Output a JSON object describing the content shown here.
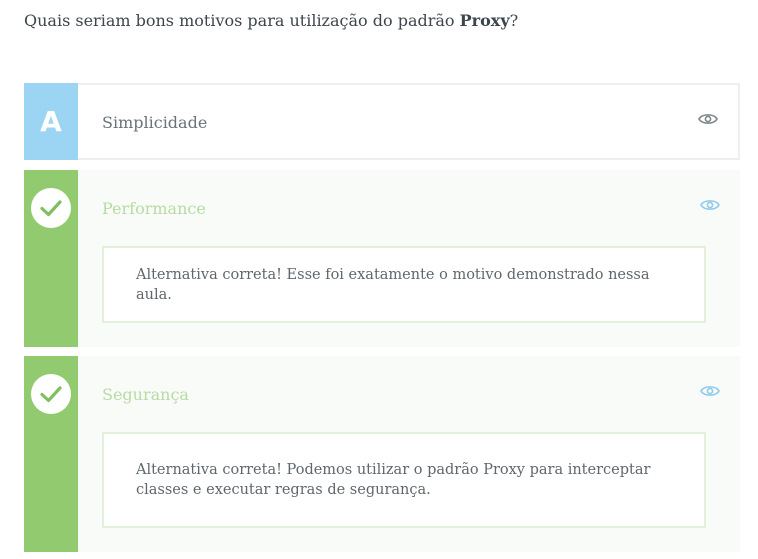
{
  "question": {
    "text_before": "Quais seriam bons motivos para utilização do padrão ",
    "bold": "Proxy",
    "text_after": "?"
  },
  "alternatives": [
    {
      "letter": "A",
      "label": "Simplicidade",
      "icon": "eye-icon",
      "color": "#9cd4f3"
    },
    {
      "label": "Performance",
      "status_icon": "check-icon",
      "icon": "eye-icon",
      "color": "#92cb6f",
      "feedback": "Alternativa correta! Esse foi exatamente o motivo demonstrado nessa aula."
    },
    {
      "label": "Segurança",
      "status_icon": "check-icon",
      "icon": "eye-icon",
      "color": "#92cb6f",
      "feedback": "Alternativa correta! Podemos utilizar o padrão Proxy para interceptar classes e executar regras de segurança."
    }
  ]
}
